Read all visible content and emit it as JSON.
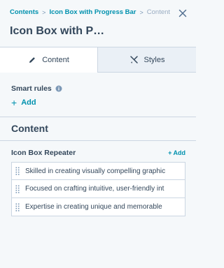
{
  "breadcrumb": {
    "items": [
      "Contents",
      "Icon Box with Progress Bar"
    ],
    "separator": ">",
    "current": "Content"
  },
  "header": {
    "title": "Icon Box with P…",
    "close_icon": "close-icon"
  },
  "tabs": [
    {
      "label": "Content",
      "icon": "pencil-icon",
      "active": true
    },
    {
      "label": "Styles",
      "icon": "paint-icon",
      "active": false
    }
  ],
  "smart_rules": {
    "label": "Smart rules",
    "add_label": "Add"
  },
  "content_section": {
    "title": "Content",
    "repeater": {
      "label": "Icon Box Repeater",
      "add_label": "+ Add",
      "items": [
        "Skilled in creating visually compelling graphic",
        "Focused on crafting intuitive, user-friendly int",
        "Expertise in creating unique and memorable"
      ]
    }
  },
  "colors": {
    "accent": "#0091ae",
    "text": "#33475b",
    "border": "#cbd6e2",
    "background": "#f5f8fa"
  }
}
